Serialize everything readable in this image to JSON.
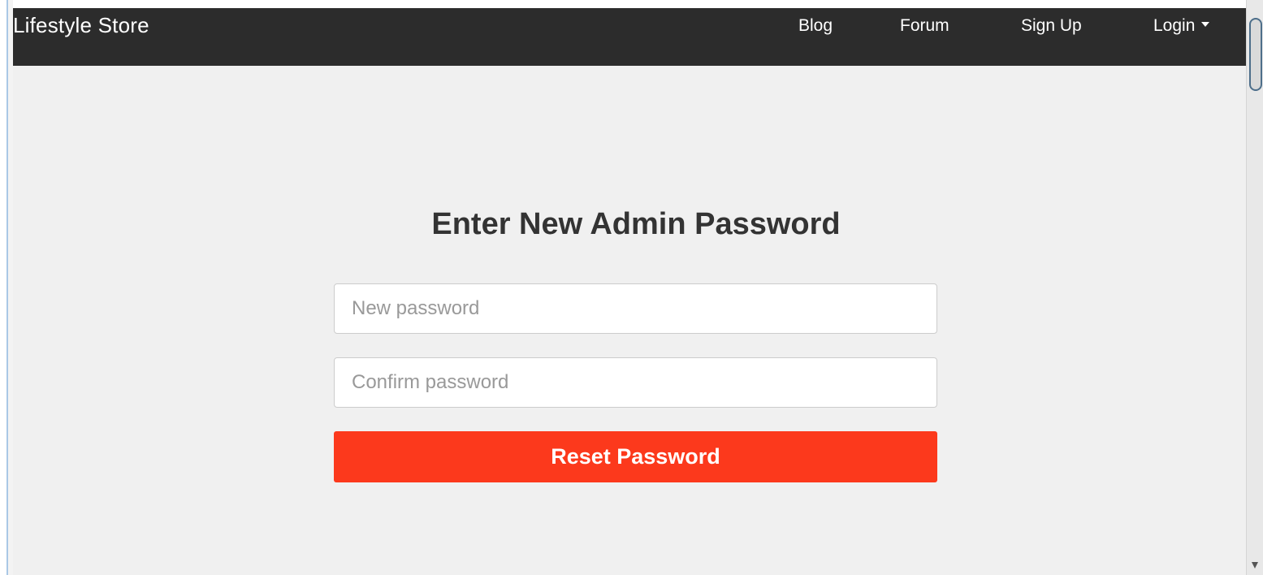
{
  "navbar": {
    "brand": "Lifestyle Store",
    "links": [
      {
        "label": "Blog"
      },
      {
        "label": "Forum"
      },
      {
        "label": "Sign Up"
      },
      {
        "label": "Login"
      }
    ]
  },
  "form": {
    "title": "Enter New Admin Password",
    "new_password": {
      "value": "",
      "placeholder": "New password"
    },
    "confirm_password": {
      "value": "",
      "placeholder": "Confirm password"
    },
    "submit_label": "Reset Password"
  },
  "colors": {
    "navbar_bg": "#2c2c2c",
    "page_bg": "#f0f0f0",
    "accent": "#fc391c"
  }
}
